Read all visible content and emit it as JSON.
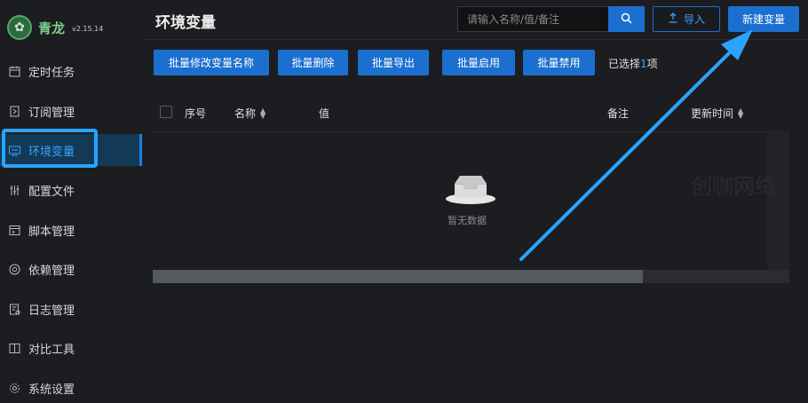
{
  "brand": {
    "logo_glyph": "✿",
    "name": "青龙",
    "version": "v2.15.14"
  },
  "sidebar": {
    "items": [
      {
        "label": "定时任务",
        "icon": "calendar-icon",
        "active": false
      },
      {
        "label": "订阅管理",
        "icon": "subscribe-icon",
        "active": false
      },
      {
        "label": "环境变量",
        "icon": "monitor-icon",
        "active": true
      },
      {
        "label": "配置文件",
        "icon": "sliders-icon",
        "active": false
      },
      {
        "label": "脚本管理",
        "icon": "script-icon",
        "active": false
      },
      {
        "label": "依赖管理",
        "icon": "dependency-icon",
        "active": false
      },
      {
        "label": "日志管理",
        "icon": "log-icon",
        "active": false
      },
      {
        "label": "对比工具",
        "icon": "compare-icon",
        "active": false
      },
      {
        "label": "系统设置",
        "icon": "gear-icon",
        "active": false
      }
    ]
  },
  "header": {
    "title": "环境变量",
    "search_placeholder": "请输入名称/值/备注",
    "import_label": "导入",
    "new_label": "新建变量"
  },
  "toolbar": {
    "batch_edit_name": "批量修改变量名称",
    "batch_delete": "批量删除",
    "batch_export": "批量导出",
    "batch_enable": "批量启用",
    "batch_disable": "批量禁用",
    "selected_prefix": "已选择",
    "selected_count": "1",
    "selected_suffix": "项"
  },
  "table": {
    "columns": {
      "index": "序号",
      "name": "名称",
      "value": "值",
      "remark": "备注",
      "updated": "更新时间"
    },
    "empty_text": "暂无数据",
    "watermark": "创咖网络",
    "scroll_fraction": 0.77
  },
  "colors": {
    "accent": "#1b6fcf",
    "highlight": "#2aa4ff",
    "brand_green": "#7fd08f"
  }
}
